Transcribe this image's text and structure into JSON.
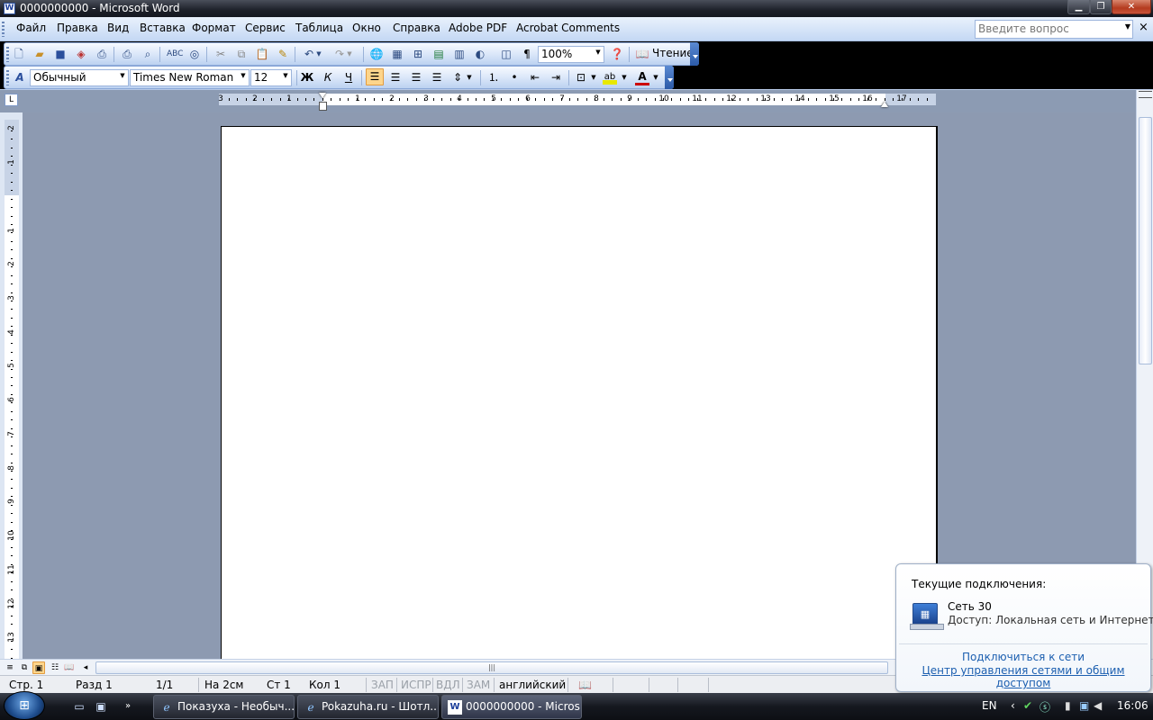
{
  "window": {
    "title": "0000000000 - Microsoft Word",
    "icon_letter": "W"
  },
  "window_buttons": {
    "min": "▁",
    "max": "❐",
    "close": "✕"
  },
  "menu": {
    "items": [
      "Файл",
      "Правка",
      "Вид",
      "Вставка",
      "Формат",
      "Сервис",
      "Таблица",
      "Окно",
      "Справка",
      "Adobe PDF",
      "Acrobat Comments"
    ],
    "ask_placeholder": "Введите вопрос",
    "close_doc": "×"
  },
  "standard_toolbar": {
    "zoom": "100%",
    "reading_label": "Чтение",
    "pilcrow": "¶",
    "icons": [
      "new-icon",
      "open-icon",
      "save-icon",
      "permission-icon",
      "print-icon",
      "print-preview-icon",
      "spelling-icon",
      "research-icon",
      "cut-icon",
      "copy-icon",
      "paste-icon",
      "format-painter-icon",
      "undo-icon",
      "redo-icon",
      "hyperlink-icon",
      "tables-borders-icon",
      "insert-table-icon",
      "insert-excel-icon",
      "columns-icon",
      "drawing-icon",
      "document-map-icon",
      "help-icon"
    ]
  },
  "format_toolbar": {
    "style": "Обычный",
    "font": "Times New Roman",
    "size": "12",
    "bold": "Ж",
    "italic": "К",
    "underline": "Ч",
    "highlight_label": "ab",
    "font_color_label": "A"
  },
  "ruler": {
    "corner": "L",
    "h_labels": [
      "3",
      "2",
      "1",
      "1",
      "2",
      "3",
      "4",
      "5",
      "6",
      "7",
      "8",
      "9",
      "10",
      "11",
      "12",
      "13",
      "14",
      "15",
      "16",
      "17"
    ],
    "v_labels": [
      "2",
      "1",
      "1",
      "2",
      "3",
      "4",
      "5",
      "6",
      "7",
      "8",
      "9",
      "10",
      "11",
      "12",
      "13"
    ]
  },
  "statusbar": {
    "page": "Стр. 1",
    "section": "Разд 1",
    "pages": "1/1",
    "at": "На 2см",
    "line": "Ст 1",
    "col": "Кол 1",
    "rec": "ЗАП",
    "trk": "ИСПР",
    "ext": "ВДЛ",
    "ovr": "ЗАМ",
    "language": "английский"
  },
  "taskbar": {
    "tasks": [
      {
        "label": "Показуха - Необыч...",
        "icon": "ie-icon"
      },
      {
        "label": "Pokazuha.ru - Шотл...",
        "icon": "ie-icon"
      },
      {
        "label": "0000000000 - Micros...",
        "icon": "word-icon"
      }
    ],
    "lang": "EN",
    "clock": "16:06"
  },
  "balloon": {
    "header": "Текущие подключения:",
    "network_name": "Сеть 30",
    "access": "Доступ:  Локальная сеть и Интернет",
    "link_connect": "Подключиться к сети",
    "link_center": "Центр управления сетями и общим доступом"
  }
}
